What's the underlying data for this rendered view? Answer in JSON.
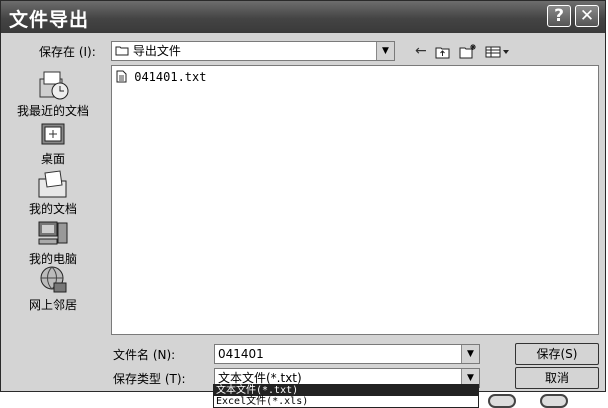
{
  "dialog": {
    "title": "文件导出",
    "help_button": "?",
    "close_button": "✕"
  },
  "save_in": {
    "label": "保存在 (I):",
    "value": "导出文件"
  },
  "places": [
    {
      "label": "我最近的文档",
      "icon": "recent-documents-icon"
    },
    {
      "label": "桌面",
      "icon": "desktop-icon"
    },
    {
      "label": "我的文档",
      "icon": "my-documents-icon"
    },
    {
      "label": "我的电脑",
      "icon": "my-computer-icon"
    },
    {
      "label": "网上邻居",
      "icon": "network-places-icon"
    }
  ],
  "files": [
    {
      "name": "041401.txt",
      "icon": "text-file-icon"
    }
  ],
  "file_name": {
    "label": "文件名 (N):",
    "value": "041401"
  },
  "save_type": {
    "label": "保存类型 (T):",
    "value": "文本文件(*.txt)",
    "options": [
      "文本文件(*.txt)",
      "Excel文件(*.xls)"
    ],
    "selected_index": 0
  },
  "buttons": {
    "save": "保存(S)",
    "cancel": "取消"
  }
}
